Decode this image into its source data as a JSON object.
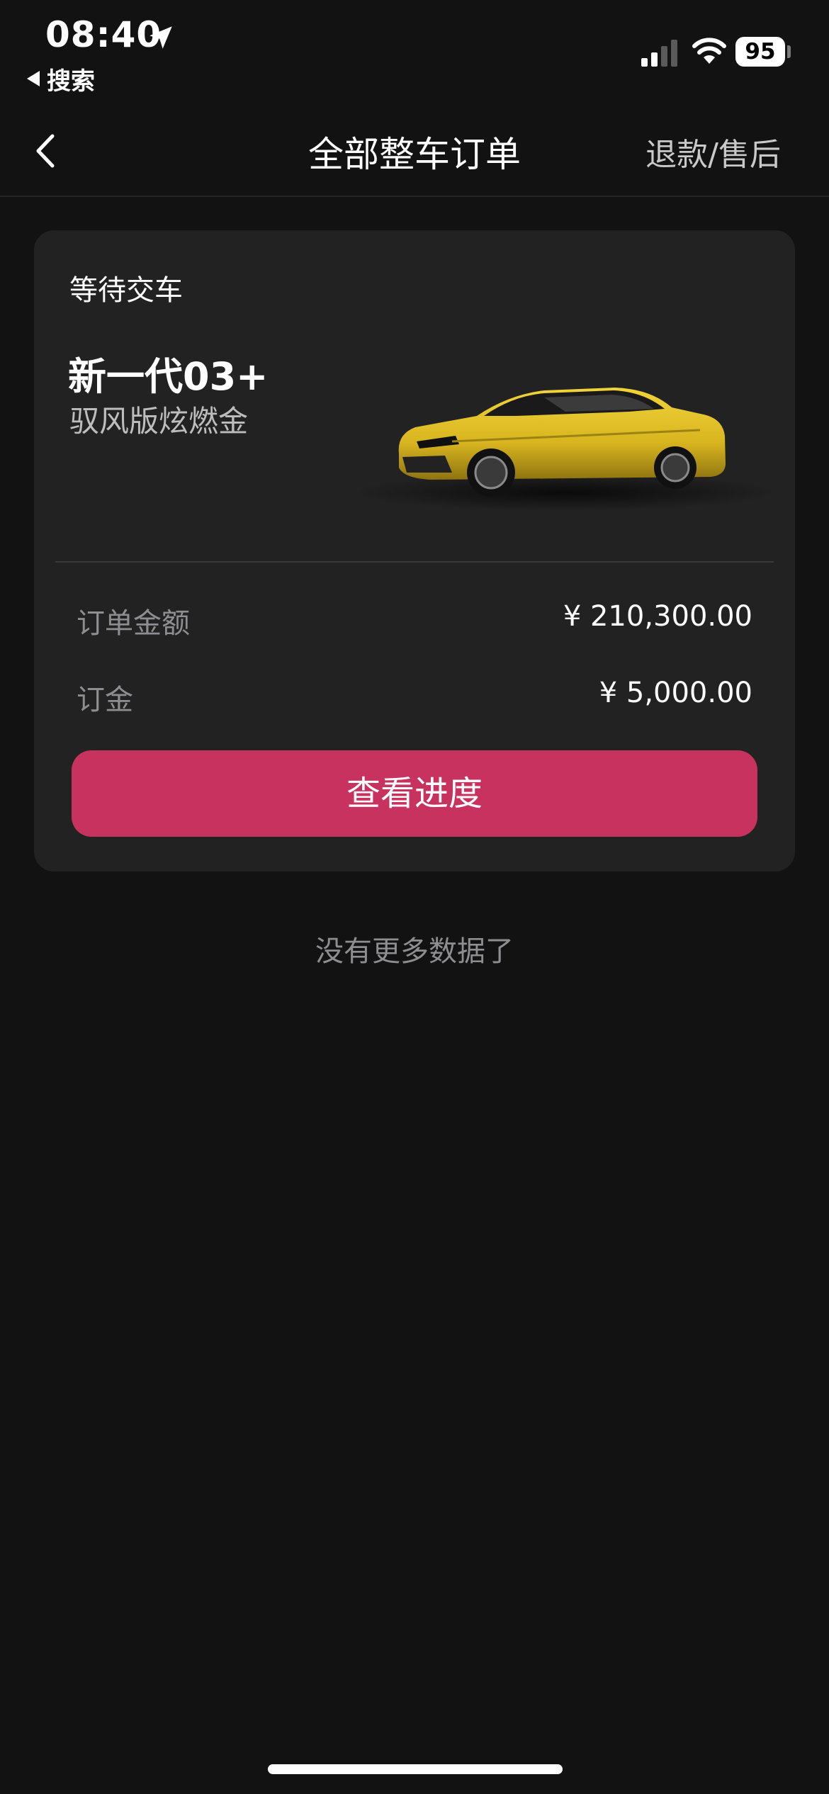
{
  "status_bar": {
    "time": "08:40",
    "back_app_label": "搜索",
    "battery_level": "95"
  },
  "nav": {
    "title": "全部整车订单",
    "action_label": "退款/售后"
  },
  "order": {
    "status": "等待交车",
    "car_name": "新一代03+",
    "car_trim": "驭风版炫燃金",
    "car_color": "#d8b51f",
    "amount_label": "订单金额",
    "amount_value": "¥ 210,300.00",
    "deposit_label": "订金",
    "deposit_value": "¥ 5,000.00",
    "action_button": "查看进度"
  },
  "footer_text": "没有更多数据了",
  "colors": {
    "background": "#121212",
    "card": "#222223",
    "accent": "#c8325f"
  }
}
